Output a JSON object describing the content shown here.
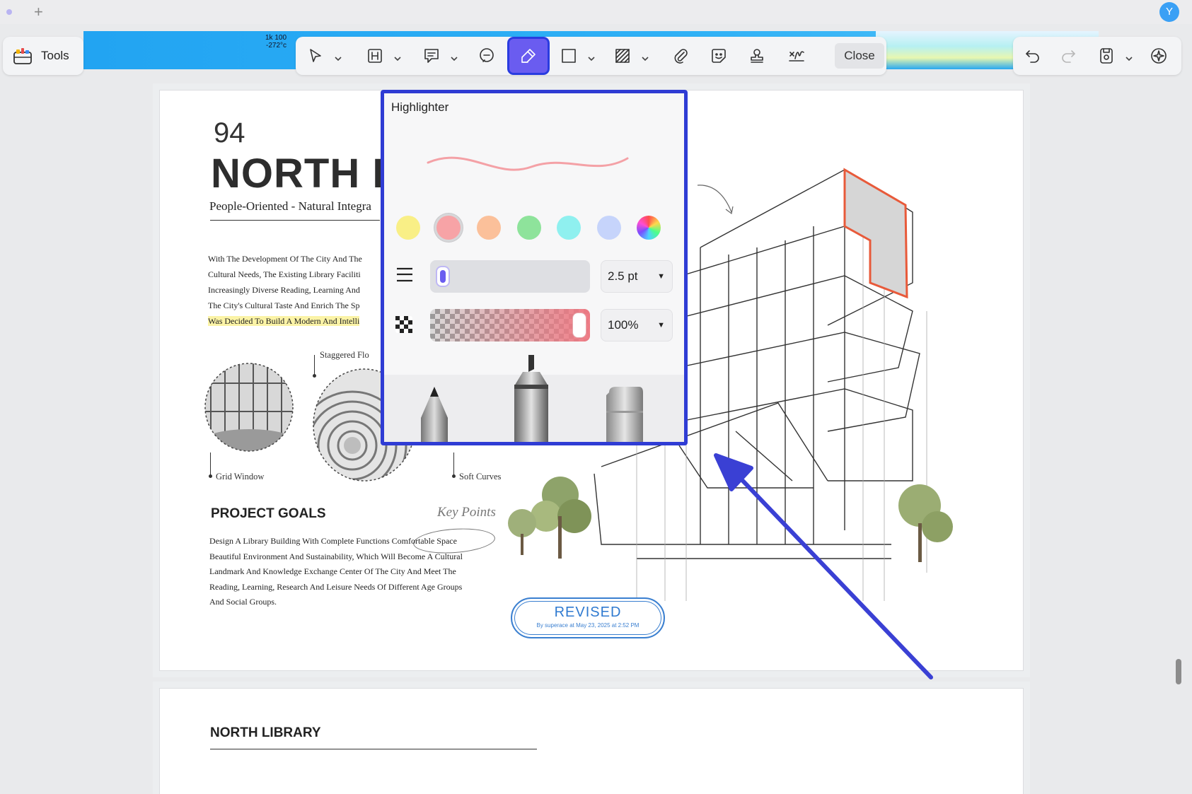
{
  "window": {
    "avatar_initial": "Y",
    "new_tab_glyph": "+"
  },
  "banner": {
    "text_line1": "1k 100",
    "text_line2": "-272°c"
  },
  "toolbar": {
    "tools_label": "Tools",
    "close_label": "Close",
    "active_tool": "highlighter",
    "items": [
      "select-tool",
      "text-box-tool",
      "comment-tool",
      "note-tool",
      "highlighter-tool",
      "rectangle-tool",
      "area-fill-tool",
      "attachment-tool",
      "sticker-tool",
      "stamp-tool",
      "signature-tool"
    ]
  },
  "document": {
    "page_number": "94",
    "title": "NORTH I",
    "subtitle": "People-Oriented - Natural Integra",
    "intro_lines": [
      "With The Development Of The City And The",
      "Cultural Needs, The Existing Library Faciliti",
      "Increasingly Diverse Reading, Learning And",
      "The City's Cultural Taste And Enrich The Sp",
      "Was Decided To Build A Modern And Intelli"
    ],
    "captions": {
      "staggered": "Staggered Flo",
      "grid": "Grid Window",
      "soft": "Soft Curves"
    },
    "goals_heading": "PROJECT GOALS",
    "key_points": "Key Points",
    "goals_lines": [
      "Design A Library Building With Complete Functions Comfortable Space",
      "Beautiful Environment And Sustainability, Which Will Become A Cultural",
      "Landmark And Knowledge Exchange Center Of The City And Meet The",
      "Reading, Learning, Research And Leisure Needs Of Different Age Groups",
      "And Social Groups."
    ],
    "stamp": {
      "title": "REVISED",
      "subtitle": "By superace at May 23, 2025 at 2:52 PM"
    },
    "page2_heading": "NORTH LIBRARY"
  },
  "highlighter_popover": {
    "title": "Highlighter",
    "colors": [
      "#f9ef86",
      "#f7a3a6",
      "#fbc09a",
      "#8ee39b",
      "#8ff0ef",
      "#c6d4fb",
      "rainbow"
    ],
    "selected_color_index": 1,
    "stroke_size": "2.5 pt",
    "stroke_size_level": 0.05,
    "opacity": "100%",
    "opacity_level": 1.0,
    "tools": [
      "pencil",
      "highlighter-marker",
      "eraser"
    ],
    "accent": "#6a5cf0",
    "frame_color": "#2f3cd4"
  }
}
